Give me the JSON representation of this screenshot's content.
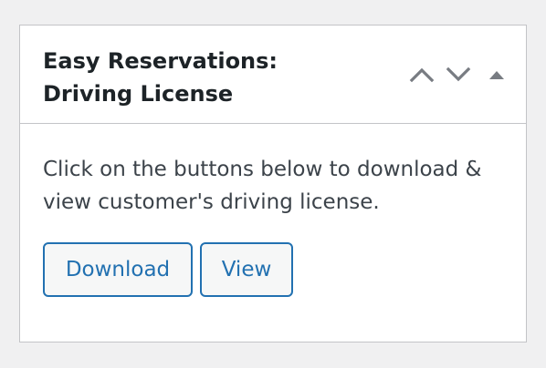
{
  "metabox": {
    "title_line1": "Easy Reservations:",
    "title_line2": "Driving License",
    "description": "Click on the buttons below to download & view customer's driving license.",
    "download_label": "Download",
    "view_label": "View"
  },
  "icons": {
    "move_up": "chevron-up-icon",
    "move_down": "chevron-down-icon",
    "toggle": "triangle-up-icon"
  },
  "colors": {
    "accent": "#2271b1",
    "icon": "#787c82",
    "title": "#1d2327",
    "text": "#3c434a",
    "border": "#c3c4c7",
    "background": "#f0f0f1",
    "button_bg": "#f6f7f7"
  }
}
